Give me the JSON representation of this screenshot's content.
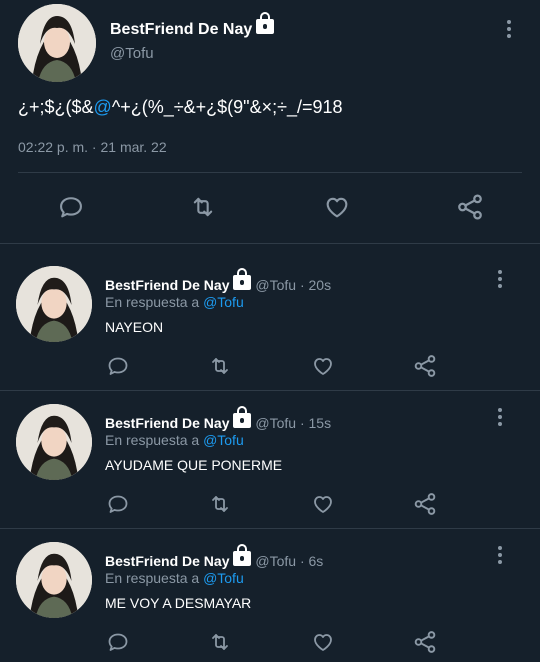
{
  "main_tweet": {
    "display_name": "BestFriend De Nay",
    "handle": "@Tofu",
    "text_before": "¿+;$¿($&",
    "text_mention": "@",
    "text_after": "^+¿(%_÷&+¿$(9\"&×;÷_/=918",
    "timestamp": "02:22 p. m. · 21 mar. 22"
  },
  "replies": [
    {
      "display_name": "BestFriend De Nay",
      "handle": "@Tofu",
      "time": "· 20s",
      "reply_prefix": "En respuesta a",
      "reply_to": "@Tofu",
      "text": "NAYEON"
    },
    {
      "display_name": "BestFriend De Nay",
      "handle": "@Tofu",
      "time": "· 15s",
      "reply_prefix": "En respuesta a",
      "reply_to": "@Tofu",
      "text": "AYUDAME QUE PONERME"
    },
    {
      "display_name": "BestFriend De Nay",
      "handle": "@Tofu",
      "time": "· 6s",
      "reply_prefix": "En respuesta a",
      "reply_to": "@Tofu",
      "text": "ME VOY A DESMAYAR"
    }
  ],
  "icons": {
    "reply": "reply-icon",
    "retweet": "retweet-icon",
    "like": "heart-icon",
    "share": "share-icon",
    "more": "more-icon",
    "lock": "lock-icon"
  },
  "colors": {
    "background": "#15202b",
    "accent": "#1d9bf0",
    "muted": "#8b98a5",
    "divider": "#2f3b47"
  }
}
